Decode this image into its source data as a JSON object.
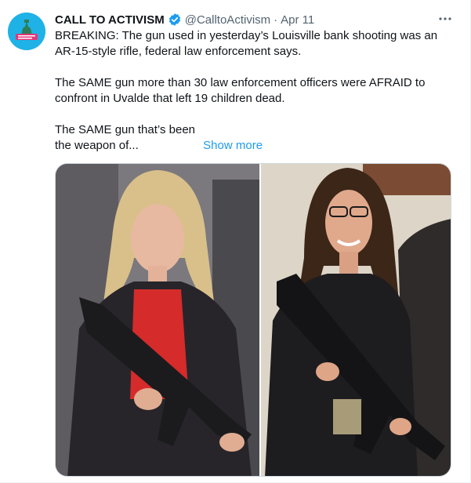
{
  "tweet": {
    "author_name": "CALL TO ACTIVISM",
    "handle": "@CalltoActivism",
    "separator": "·",
    "date": "Apr 11",
    "more_icon": "ellipsis-icon",
    "avatar_icon": "call-to-activism-logo",
    "paragraphs": [
      "BREAKING: The gun used in yesterday’s Louisville bank shooting was an AR-15-style rifle, federal law enforcement  says.",
      "The SAME gun more than 30 law enforcement officers were AFRAID to confront in Uvalde that left 19 children dead.",
      "The SAME gun that’s been the weapon of..."
    ],
    "show_more": "Show more",
    "colors": {
      "link": "#1d9bf0",
      "verified": "#1d9bf0",
      "secondary_text": "#536471",
      "avatar_bg": "#1fb2e6"
    }
  },
  "media": {
    "count": 2,
    "photos": [
      "photo-left",
      "photo-right"
    ]
  }
}
